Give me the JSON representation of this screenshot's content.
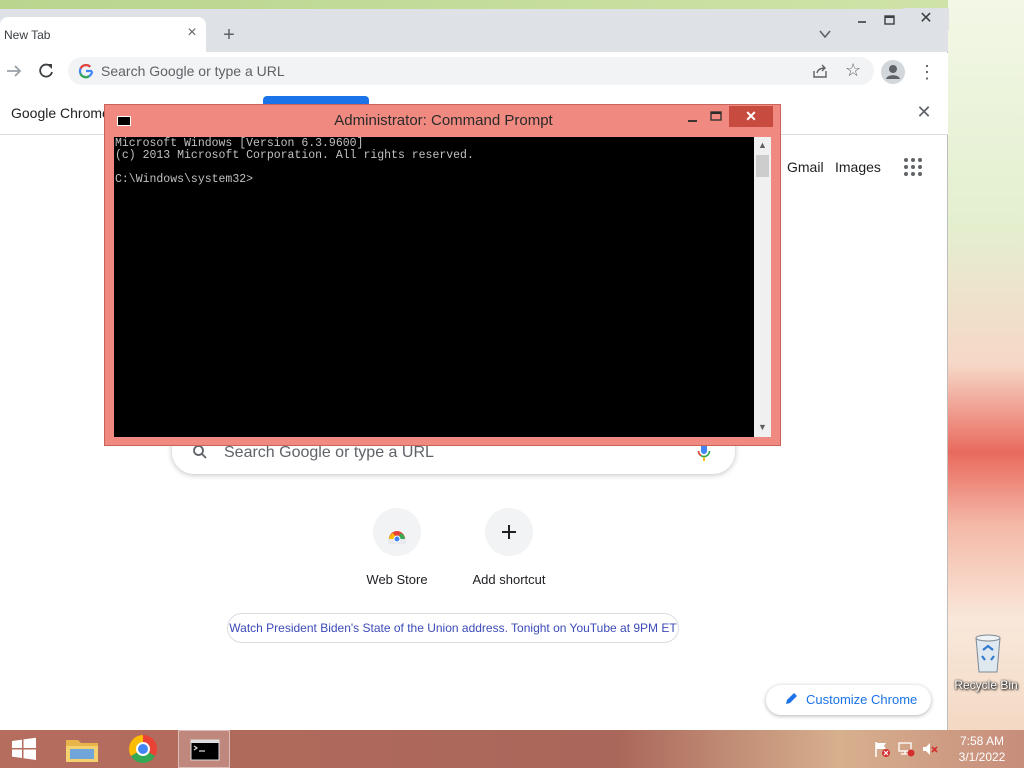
{
  "chrome": {
    "tab_title": "New Tab",
    "tab_close": "×",
    "new_tab": "+",
    "window_close": "✕",
    "omnibox_placeholder": "Search Google or type a URL",
    "infobar_text": "Google Chrome",
    "infobar_close": "✕",
    "top_links": [
      "Gmail",
      "Images"
    ],
    "search_placeholder": "Search Google or type a URL",
    "shortcuts": [
      {
        "label": "Web Store",
        "icon": "chrome-web-store-icon"
      },
      {
        "label": "Add shortcut",
        "icon": "plus-icon"
      }
    ],
    "promo_text": "Watch President Biden's State of the Union address. Tonight on YouTube at 9PM ET",
    "customize_label": "Customize Chrome",
    "accent": "#1a73e8"
  },
  "cmd": {
    "title": "Administrator: Command Prompt",
    "close": "✕",
    "console_lines": [
      "Microsoft Windows [Version 6.3.9600]",
      "(c) 2013 Microsoft Corporation. All rights reserved.",
      "",
      "C:\\Windows\\system32>"
    ],
    "frame_color": "#f08a80"
  },
  "desktop": {
    "recycle_bin_label": "Recycle Bin"
  },
  "taskbar": {
    "items": [
      "start-button",
      "file-explorer",
      "google-chrome",
      "command-prompt"
    ],
    "clock_time": "7:58 AM",
    "clock_date": "3/1/2022"
  }
}
